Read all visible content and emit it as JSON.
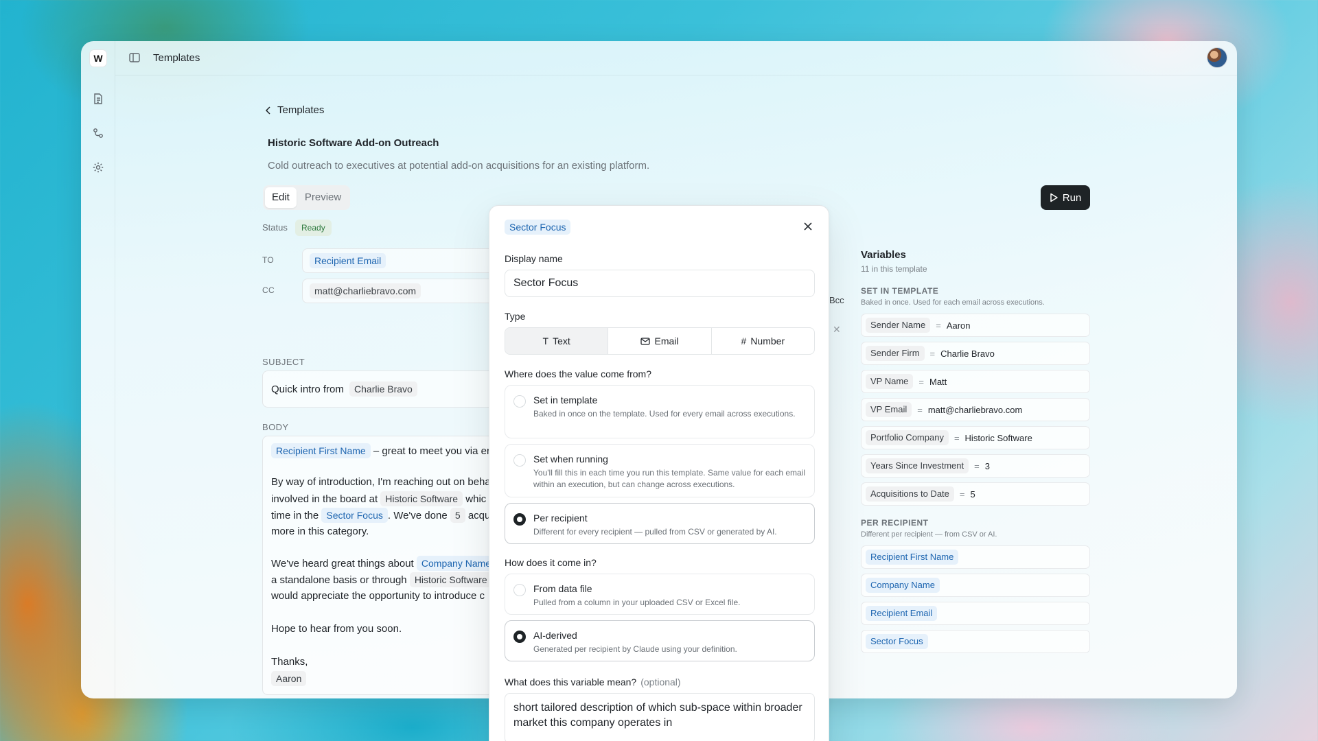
{
  "app": {
    "logo": "W",
    "title": "Templates",
    "rail_icons": [
      "document-icon",
      "workflow-icon",
      "gear-icon"
    ]
  },
  "page": {
    "back_label": "Templates",
    "title": "Historic Software Add-on Outreach",
    "description": "Cold outreach to executives at potential add-on acquisitions for an existing platform.",
    "tabs": [
      {
        "label": "Edit",
        "active": true
      },
      {
        "label": "Preview",
        "active": false
      }
    ],
    "run_label": "Run",
    "status_label": "Status",
    "status_value": "Ready"
  },
  "email": {
    "to_label": "TO",
    "to_chip": "Recipient Email",
    "cc_label": "CC",
    "cc_value": "matt@charliebravo.com",
    "bcc_label": "Bcc",
    "subject_label": "SUBJECT",
    "subject_text": "Quick intro from",
    "subject_chip": "Charlie Bravo",
    "body_label": "BODY",
    "body": {
      "l1_chip": "Recipient First Name",
      "l1_text": "– great to meet you via er",
      "l2_text": "By way of introduction, I'm reaching out on beha",
      "l3_text_a": "involved in the board at",
      "l3_chip": "Historic Software",
      "l3_text_b": "whic",
      "l4_text_a": "time in the",
      "l4_chip": "Sector Focus",
      "l4_text_b": ". We've done",
      "l4_chip2": "5",
      "l4_text_c": "acqu",
      "l5_text": "more in this category.",
      "l6_text_a": "We've heard great things about",
      "l6_chip": "Company Name",
      "l7_text_a": "a standalone basis or through",
      "l7_chip": "Historic Software",
      "l8_text": "would appreciate the opportunity to introduce c",
      "l9_text": "Hope to hear from you soon.",
      "l10_text": "Thanks,",
      "l11_chip": "Aaron"
    }
  },
  "variables": {
    "title": "Variables",
    "count": "11 in this template",
    "set_in_template_label": "SET IN TEMPLATE",
    "set_in_template_desc": "Baked in once. Used for each email across executions.",
    "set_items": [
      {
        "key": "Sender Name",
        "value": "Aaron"
      },
      {
        "key": "Sender Firm",
        "value": "Charlie Bravo"
      },
      {
        "key": "VP Name",
        "value": "Matt"
      },
      {
        "key": "VP Email",
        "value": "matt@charliebravo.com"
      },
      {
        "key": "Portfolio Company",
        "value": "Historic Software"
      },
      {
        "key": "Years Since Investment",
        "value": "3"
      },
      {
        "key": "Acquisitions to Date",
        "value": "5"
      }
    ],
    "per_recipient_label": "PER RECIPIENT",
    "per_recipient_desc": "Different per recipient — from CSV or AI.",
    "per_items": [
      "Recipient First Name",
      "Company Name",
      "Recipient Email",
      "Sector Focus"
    ]
  },
  "dialog": {
    "chip": "Sector Focus",
    "display_name_label": "Display name",
    "display_name_value": "Sector Focus",
    "type_label": "Type",
    "type_options": [
      {
        "label": "Text",
        "icon": "text-icon",
        "selected": true
      },
      {
        "label": "Email",
        "icon": "mail-icon",
        "selected": false
      },
      {
        "label": "Number",
        "icon": "hash-icon",
        "selected": false
      }
    ],
    "source_label": "Where does the value come from?",
    "source_options": [
      {
        "title": "Set in template",
        "desc": "Baked in once on the template. Used for every email across executions.",
        "selected": false
      },
      {
        "title": "Set when running",
        "desc": "You'll fill this in each time you run this template. Same value for each email within an execution, but can change across executions.",
        "selected": false
      },
      {
        "title": "Per recipient",
        "desc": "Different for every recipient — pulled from CSV or generated by AI.",
        "selected": true
      }
    ],
    "input_label": "How does it come in?",
    "input_options": [
      {
        "title": "From data file",
        "desc": "Pulled from a column in your uploaded CSV or Excel file.",
        "selected": false
      },
      {
        "title": "AI-derived",
        "desc": "Generated per recipient by Claude using your definition.",
        "selected": true
      }
    ],
    "meaning_label": "What does this variable mean?",
    "meaning_optional": "(optional)",
    "meaning_value": "short tailored description of which sub-space within broader market this company operates in"
  }
}
